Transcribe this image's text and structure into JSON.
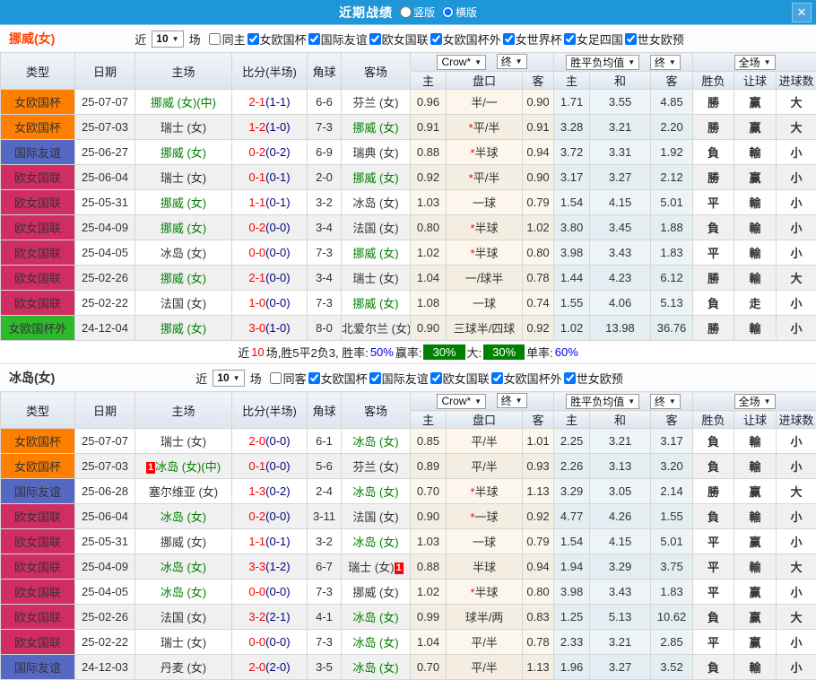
{
  "titlebar": {
    "title": "近期战绩",
    "radio_vertical": "竖版",
    "radio_horizontal": "横版",
    "orientation_checked": "horizontal",
    "close_glyph": "✕"
  },
  "filter_labels": {
    "near": "近",
    "matches": "场"
  },
  "table_header": {
    "cols": [
      "类型",
      "日期",
      "主场",
      "比分(半场)",
      "角球",
      "客场"
    ],
    "sub": [
      "主",
      "盘口",
      "客",
      "主",
      "和",
      "客",
      "胜负",
      "让球",
      "进球数"
    ],
    "selects": {
      "bookmaker": "Crow*",
      "final1": "终",
      "avg": "胜平负均值",
      "final2": "终",
      "scope": "全场"
    }
  },
  "colors": {
    "accent_blue": "#1e96d8",
    "win": "#e60000",
    "lose": "#008800",
    "draw": "#1414e6",
    "score": "#ff0000",
    "half_score": "#000080",
    "focus_team_green": "#008000",
    "summary_badge_green": "#008000"
  },
  "type_colors": {
    "女欧国杯": "#ff8000",
    "国际友谊": "#5568c4",
    "欧女国联": "#d02e62",
    "女欧国杯外": "#2eb82e"
  },
  "sections": [
    {
      "team": "挪威(女)",
      "team_color": "#ff4400",
      "filters": {
        "count": "10",
        "same_label": "同主",
        "same_checked": false,
        "leagues": [
          "女欧国杯",
          "国际友谊",
          "欧女国联",
          "女欧国杯外",
          "女世界杯",
          "女足四国",
          "世女欧预"
        ]
      },
      "rows": [
        {
          "type": "女欧国杯",
          "date": "25-07-07",
          "home": "挪威 (女)(中)",
          "hg": true,
          "score": "2-1",
          "half": "(1-1)",
          "corner": "6-6",
          "away": "芬兰 (女)",
          "o1": "0.96",
          "pan": "半/一",
          "o2": "0.90",
          "m1": "1.71",
          "m2": "3.55",
          "m3": "4.85",
          "r": [
            "勝",
            "赢",
            "大"
          ],
          "rc": [
            "w",
            "w",
            "w"
          ]
        },
        {
          "type": "女欧国杯",
          "date": "25-07-03",
          "home": "瑞士 (女)",
          "score": "1-2",
          "half": "(1-0)",
          "corner": "7-3",
          "away": "挪威 (女)",
          "ag": true,
          "o1": "0.91",
          "pan": "平/半",
          "star": true,
          "o2": "0.91",
          "m1": "3.28",
          "m2": "3.21",
          "m3": "2.20",
          "r": [
            "勝",
            "赢",
            "大"
          ],
          "rc": [
            "w",
            "w",
            "w"
          ]
        },
        {
          "type": "国际友谊",
          "date": "25-06-27",
          "home": "挪威 (女)",
          "hg": true,
          "score": "0-2",
          "half": "(0-2)",
          "corner": "6-9",
          "away": "瑞典 (女)",
          "o1": "0.88",
          "pan": "半球",
          "star": true,
          "o2": "0.94",
          "m1": "3.72",
          "m2": "3.31",
          "m3": "1.92",
          "r": [
            "負",
            "輸",
            "小"
          ],
          "rc": [
            "l",
            "l",
            "l"
          ]
        },
        {
          "type": "欧女国联",
          "date": "25-06-04",
          "home": "瑞士 (女)",
          "score": "0-1",
          "half": "(0-1)",
          "corner": "2-0",
          "away": "挪威 (女)",
          "ag": true,
          "o1": "0.92",
          "pan": "平/半",
          "star": true,
          "o2": "0.90",
          "m1": "3.17",
          "m2": "3.27",
          "m3": "2.12",
          "r": [
            "勝",
            "赢",
            "小"
          ],
          "rc": [
            "w",
            "w",
            "l"
          ]
        },
        {
          "type": "欧女国联",
          "date": "25-05-31",
          "home": "挪威 (女)",
          "hg": true,
          "score": "1-1",
          "half": "(0-1)",
          "corner": "3-2",
          "away": "冰岛 (女)",
          "o1": "1.03",
          "pan": "一球",
          "o2": "0.79",
          "m1": "1.54",
          "m2": "4.15",
          "m3": "5.01",
          "r": [
            "平",
            "輸",
            "小"
          ],
          "rc": [
            "d",
            "l",
            "l"
          ]
        },
        {
          "type": "欧女国联",
          "date": "25-04-09",
          "home": "挪威 (女)",
          "hg": true,
          "score": "0-2",
          "half": "(0-0)",
          "corner": "3-4",
          "away": "法国 (女)",
          "o1": "0.80",
          "pan": "半球",
          "star": true,
          "o2": "1.02",
          "m1": "3.80",
          "m2": "3.45",
          "m3": "1.88",
          "r": [
            "負",
            "輸",
            "小"
          ],
          "rc": [
            "l",
            "l",
            "l"
          ]
        },
        {
          "type": "欧女国联",
          "date": "25-04-05",
          "home": "冰岛 (女)",
          "score": "0-0",
          "half": "(0-0)",
          "corner": "7-3",
          "away": "挪威 (女)",
          "ag": true,
          "o1": "1.02",
          "pan": "半球",
          "star": true,
          "o2": "0.80",
          "m1": "3.98",
          "m2": "3.43",
          "m3": "1.83",
          "r": [
            "平",
            "輸",
            "小"
          ],
          "rc": [
            "d",
            "l",
            "l"
          ]
        },
        {
          "type": "欧女国联",
          "date": "25-02-26",
          "home": "挪威 (女)",
          "hg": true,
          "score": "2-1",
          "half": "(0-0)",
          "corner": "3-4",
          "away": "瑞士 (女)",
          "o1": "1.04",
          "pan": "一/球半",
          "o2": "0.78",
          "m1": "1.44",
          "m2": "4.23",
          "m3": "6.12",
          "r": [
            "勝",
            "輸",
            "大"
          ],
          "rc": [
            "w",
            "l",
            "w"
          ]
        },
        {
          "type": "欧女国联",
          "date": "25-02-22",
          "home": "法国 (女)",
          "score": "1-0",
          "half": "(0-0)",
          "corner": "7-3",
          "away": "挪威 (女)",
          "ag": true,
          "o1": "1.08",
          "pan": "一球",
          "o2": "0.74",
          "m1": "1.55",
          "m2": "4.06",
          "m3": "5.13",
          "r": [
            "負",
            "走",
            "小"
          ],
          "rc": [
            "l",
            "d",
            "l"
          ]
        },
        {
          "type": "女欧国杯外",
          "date": "24-12-04",
          "home": "挪威 (女)",
          "hg": true,
          "score": "3-0",
          "half": "(1-0)",
          "corner": "8-0",
          "away": "北爱尔兰 (女)",
          "o1": "0.90",
          "pan": "三球半/四球",
          "o2": "0.92",
          "m1": "1.02",
          "m2": "13.98",
          "m3": "36.76",
          "r": [
            "勝",
            "輸",
            "小"
          ],
          "rc": [
            "w",
            "l",
            "l"
          ]
        }
      ],
      "summary": {
        "near": "近",
        "count": "10",
        "rest": "场,胜5平2负3, 胜率:",
        "win_rate": "50%",
        "win_odds_label": "赢率:",
        "win_odds": "30%",
        "big_label": "大:",
        "big": "30%",
        "single_label": "单率:",
        "single": "60%"
      }
    },
    {
      "team": "冰岛(女)",
      "team_color": "#333333",
      "filters": {
        "count": "10",
        "same_label": "同客",
        "same_checked": false,
        "leagues": [
          "女欧国杯",
          "国际友谊",
          "欧女国联",
          "女欧国杯外",
          "世女欧预"
        ]
      },
      "rows": [
        {
          "type": "女欧国杯",
          "date": "25-07-07",
          "home": "瑞士 (女)",
          "score": "2-0",
          "half": "(0-0)",
          "corner": "6-1",
          "away": "冰岛 (女)",
          "ag": true,
          "o1": "0.85",
          "pan": "平/半",
          "o2": "1.01",
          "m1": "2.25",
          "m2": "3.21",
          "m3": "3.17",
          "r": [
            "負",
            "輸",
            "小"
          ],
          "rc": [
            "l",
            "l",
            "l"
          ]
        },
        {
          "type": "女欧国杯",
          "date": "25-07-03",
          "home": "冰岛 (女)(中)",
          "hg": true,
          "hbadge": "1",
          "score": "0-1",
          "half": "(0-0)",
          "corner": "5-6",
          "away": "芬兰 (女)",
          "o1": "0.89",
          "pan": "平/半",
          "o2": "0.93",
          "m1": "2.26",
          "m2": "3.13",
          "m3": "3.20",
          "r": [
            "負",
            "輸",
            "小"
          ],
          "rc": [
            "l",
            "l",
            "l"
          ]
        },
        {
          "type": "国际友谊",
          "date": "25-06-28",
          "home": "塞尔维亚 (女)",
          "score": "1-3",
          "half": "(0-2)",
          "corner": "2-4",
          "away": "冰岛 (女)",
          "ag": true,
          "o1": "0.70",
          "pan": "半球",
          "star": true,
          "o2": "1.13",
          "m1": "3.29",
          "m2": "3.05",
          "m3": "2.14",
          "r": [
            "勝",
            "赢",
            "大"
          ],
          "rc": [
            "w",
            "w",
            "w"
          ]
        },
        {
          "type": "欧女国联",
          "date": "25-06-04",
          "home": "冰岛 (女)",
          "hg": true,
          "score": "0-2",
          "half": "(0-0)",
          "corner": "3-11",
          "away": "法国 (女)",
          "o1": "0.90",
          "pan": "一球",
          "star": true,
          "o2": "0.92",
          "m1": "4.77",
          "m2": "4.26",
          "m3": "1.55",
          "r": [
            "負",
            "輸",
            "小"
          ],
          "rc": [
            "l",
            "l",
            "l"
          ]
        },
        {
          "type": "欧女国联",
          "date": "25-05-31",
          "home": "挪威 (女)",
          "score": "1-1",
          "half": "(0-1)",
          "corner": "3-2",
          "away": "冰岛 (女)",
          "ag": true,
          "o1": "1.03",
          "pan": "一球",
          "o2": "0.79",
          "m1": "1.54",
          "m2": "4.15",
          "m3": "5.01",
          "r": [
            "平",
            "赢",
            "小"
          ],
          "rc": [
            "d",
            "w",
            "l"
          ]
        },
        {
          "type": "欧女国联",
          "date": "25-04-09",
          "home": "冰岛 (女)",
          "hg": true,
          "score": "3-3",
          "half": "(1-2)",
          "corner": "6-7",
          "away": "瑞士 (女)",
          "abadge": "1",
          "o1": "0.88",
          "pan": "半球",
          "o2": "0.94",
          "m1": "1.94",
          "m2": "3.29",
          "m3": "3.75",
          "r": [
            "平",
            "輸",
            "大"
          ],
          "rc": [
            "d",
            "l",
            "w"
          ]
        },
        {
          "type": "欧女国联",
          "date": "25-04-05",
          "home": "冰岛 (女)",
          "hg": true,
          "score": "0-0",
          "half": "(0-0)",
          "corner": "7-3",
          "away": "挪威 (女)",
          "o1": "1.02",
          "pan": "半球",
          "star": true,
          "o2": "0.80",
          "m1": "3.98",
          "m2": "3.43",
          "m3": "1.83",
          "r": [
            "平",
            "赢",
            "小"
          ],
          "rc": [
            "d",
            "w",
            "l"
          ]
        },
        {
          "type": "欧女国联",
          "date": "25-02-26",
          "home": "法国 (女)",
          "score": "3-2",
          "half": "(2-1)",
          "corner": "4-1",
          "away": "冰岛 (女)",
          "ag": true,
          "o1": "0.99",
          "pan": "球半/两",
          "o2": "0.83",
          "m1": "1.25",
          "m2": "5.13",
          "m3": "10.62",
          "r": [
            "負",
            "赢",
            "大"
          ],
          "rc": [
            "l",
            "w",
            "w"
          ]
        },
        {
          "type": "欧女国联",
          "date": "25-02-22",
          "home": "瑞士 (女)",
          "score": "0-0",
          "half": "(0-0)",
          "corner": "7-3",
          "away": "冰岛 (女)",
          "ag": true,
          "o1": "1.04",
          "pan": "平/半",
          "o2": "0.78",
          "m1": "2.33",
          "m2": "3.21",
          "m3": "2.85",
          "r": [
            "平",
            "赢",
            "小"
          ],
          "rc": [
            "d",
            "w",
            "l"
          ]
        },
        {
          "type": "国际友谊",
          "date": "24-12-03",
          "home": "丹麦 (女)",
          "score": "2-0",
          "half": "(2-0)",
          "corner": "3-5",
          "away": "冰岛 (女)",
          "ag": true,
          "o1": "0.70",
          "pan": "平/半",
          "o2": "1.13",
          "m1": "1.96",
          "m2": "3.27",
          "m3": "3.52",
          "r": [
            "負",
            "輸",
            "小"
          ],
          "rc": [
            "l",
            "l",
            "l"
          ]
        }
      ],
      "summary": null
    }
  ]
}
